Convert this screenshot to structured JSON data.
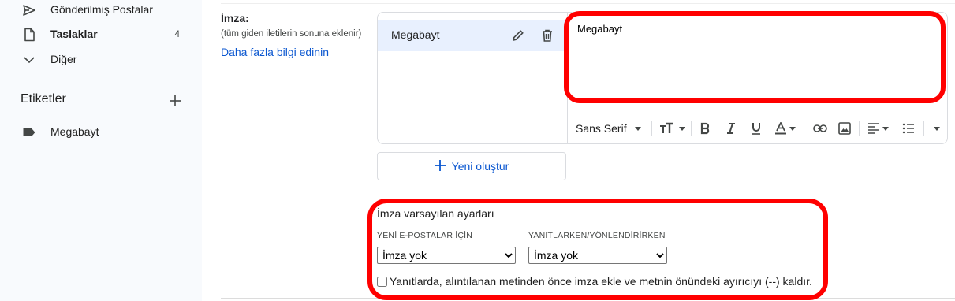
{
  "sidebar": {
    "items": [
      {
        "label": "Gönderilmiş Postalar",
        "icon": "send-icon",
        "count": ""
      },
      {
        "label": "Taslaklar",
        "icon": "draft-icon",
        "count": "4"
      },
      {
        "label": "Diğer",
        "icon": "chevron-down-icon",
        "count": ""
      }
    ],
    "labels_header": "Etiketler",
    "labels": [
      {
        "label": "Megabayt",
        "icon": "label-icon"
      }
    ]
  },
  "signature": {
    "title": "İmza:",
    "subtitle": "(tüm giden iletilerin sonuna eklenir)",
    "learn_more": "Daha fazla bilgi edinin",
    "list": [
      {
        "name": "Megabayt"
      }
    ],
    "editor_text": "Megabayt",
    "toolbar": {
      "font": "Sans Serif"
    },
    "new_button": "Yeni oluştur"
  },
  "defaults": {
    "title": "İmza varsayılan ayarları",
    "new_emails_label": "YENİ E-POSTALAR İÇİN",
    "new_emails_value": "İmza yok",
    "reply_label": "YANITLARKEN/YÖNLENDİRİRKEN",
    "reply_value": "İmza yok",
    "checkbox_label": "Yanıtlarda, alıntılanan metinden önce imza ekle ve metnin önündeki ayırıcıyı (--) kaldır.",
    "checkbox_checked": false
  },
  "colors": {
    "accent": "#0b57d0",
    "highlight": "#ff0000",
    "selected_item": "#e8f0fe",
    "sidebar_bg": "#f8fafd"
  }
}
